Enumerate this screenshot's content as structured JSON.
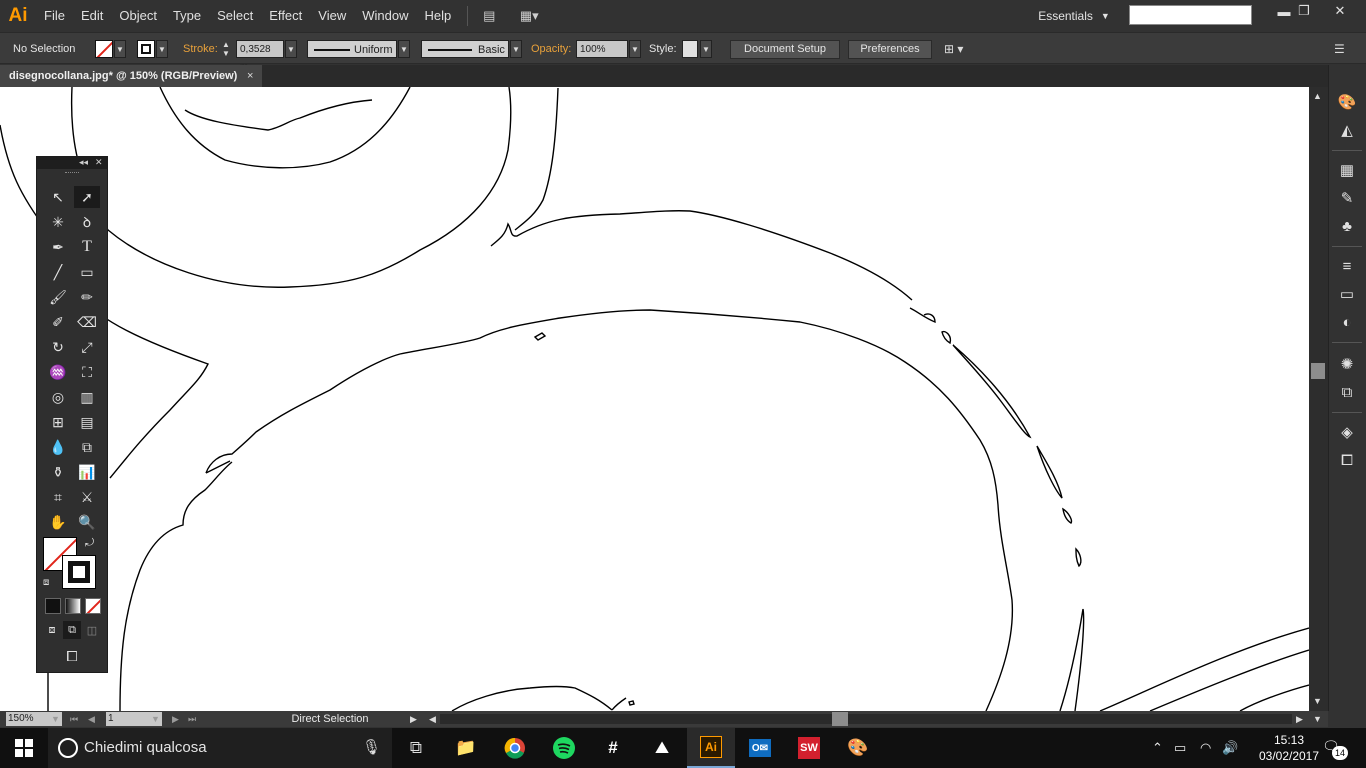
{
  "app": {
    "logo": "Ai"
  },
  "menu": [
    "File",
    "Edit",
    "Object",
    "Type",
    "Select",
    "Effect",
    "View",
    "Window",
    "Help"
  ],
  "workspace": {
    "label": "Essentials"
  },
  "control_bar": {
    "selection": "No Selection",
    "stroke_label": "Stroke:",
    "stroke_weight": "0,3528 m",
    "profile": "Uniform",
    "brush": "Basic",
    "opacity_label": "Opacity:",
    "opacity_value": "100%",
    "style_label": "Style:",
    "document_setup": "Document Setup",
    "preferences": "Preferences"
  },
  "document_tab": {
    "title": "disegnocollana.jpg* @ 150% (RGB/Preview)",
    "close": "×"
  },
  "status_bar": {
    "zoom": "150%",
    "page": "1",
    "tool": "Direct Selection"
  },
  "taskbar": {
    "search_placeholder": "Chiedimi qualcosa",
    "time": "15:13",
    "date": "03/02/2017",
    "notifications": "14",
    "apps": [
      "file-explorer",
      "chrome",
      "spotify",
      "slack",
      "photos",
      "illustrator",
      "outlook",
      "solidworks",
      "paint"
    ]
  },
  "colors": {
    "accent": "#ff9a00",
    "panel": "#323232",
    "canvas": "#ffffff"
  }
}
